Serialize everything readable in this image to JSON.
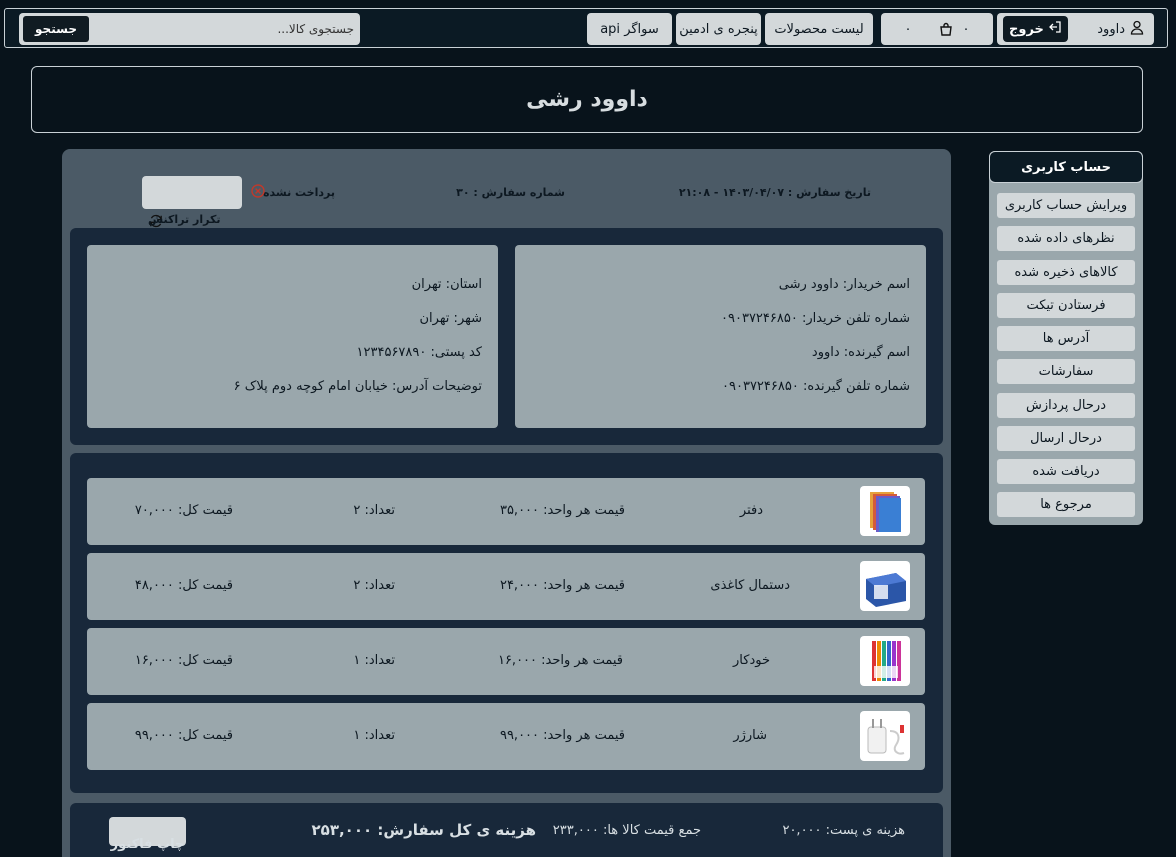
{
  "topbar": {
    "search_placeholder": "جستجوی کالا...",
    "search_button": "جستجو",
    "swagger": "سواگر api",
    "admin_panel": "پنجره ی ادمین",
    "products_list": "لیست محصولات",
    "count_left": "۰",
    "count_right": "۰",
    "logout": "خروج",
    "username": "داوود"
  },
  "header": {
    "title": "داوود رشی"
  },
  "order": {
    "date": "تاریخ سفارش : ۱۴۰۳/۰۴/۰۷ - ۲۱:۰۸",
    "number": "شماره سفارش : ۳۰",
    "status": "پرداخت نشده",
    "status_color": "#c0392b",
    "repeat_button": "تکرار تراکنش"
  },
  "buyer": {
    "name": "اسم خریدار: داوود رشی",
    "phone": "شماره تلفن خریدار: ۰۹۰۳۷۲۴۶۸۵۰",
    "receiver": "اسم گیرنده: داوود",
    "receiver_phone": "شماره تلفن گیرنده: ۰۹۰۳۷۲۴۶۸۵۰"
  },
  "address": {
    "province": "استان: تهران",
    "city": "شهر: تهران",
    "postal": "کد پستی: ۱۲۳۴۵۶۷۸۹۰",
    "details": "توضیحات آدرس: خیابان امام کوچه دوم پلاک ۶"
  },
  "items": [
    {
      "name": "دفتر",
      "unit_price": "قیمت هر واحد: ۳۵,۰۰۰",
      "qty": "تعداد: ۲",
      "total": "قیمت کل: ۷۰,۰۰۰",
      "image": "notebook-image"
    },
    {
      "name": "دستمال کاغذی",
      "unit_price": "قیمت هر واحد: ۲۴,۰۰۰",
      "qty": "تعداد: ۲",
      "total": "قیمت کل: ۴۸,۰۰۰",
      "image": "tissue-image"
    },
    {
      "name": "خودکار",
      "unit_price": "قیمت هر واحد: ۱۶,۰۰۰",
      "qty": "تعداد: ۱",
      "total": "قیمت کل: ۱۶,۰۰۰",
      "image": "pens-image"
    },
    {
      "name": "شارژر",
      "unit_price": "قیمت هر واحد: ۹۹,۰۰۰",
      "qty": "تعداد: ۱",
      "total": "قیمت کل: ۹۹,۰۰۰",
      "image": "charger-image"
    }
  ],
  "totals": {
    "shipping": "هزینه ی پست: ۲۰,۰۰۰",
    "items_sum": "جمع قیمت کالا ها: ۲۳۳,۰۰۰",
    "grand_total": "هزینه ی کل سفارش: ۲۵۳,۰۰۰",
    "print_button": "چاپ فاکتور"
  },
  "sidebar": {
    "title": "حساب کاربری",
    "items": [
      "ویرایش حساب کاربری",
      "نظرهای داده شده",
      "کالاهای ذخیره شده",
      "فرستادن تیکت",
      "آدرس ها",
      "سفارشات",
      "درحال پردازش",
      "درحال ارسال",
      "دریافت شده",
      "مرجوع ها"
    ]
  },
  "colors": {
    "page_bg": "#08131b",
    "panel_bg": "#4b5a66",
    "inner_bg": "#18283a",
    "card_bg": "#9aa7ac",
    "button_bg": "#d3d8da"
  },
  "icons": {
    "user": "user-icon",
    "logout": "logout-icon",
    "cart": "cart-icon",
    "refresh": "refresh-icon",
    "status": "close-circle-icon"
  }
}
